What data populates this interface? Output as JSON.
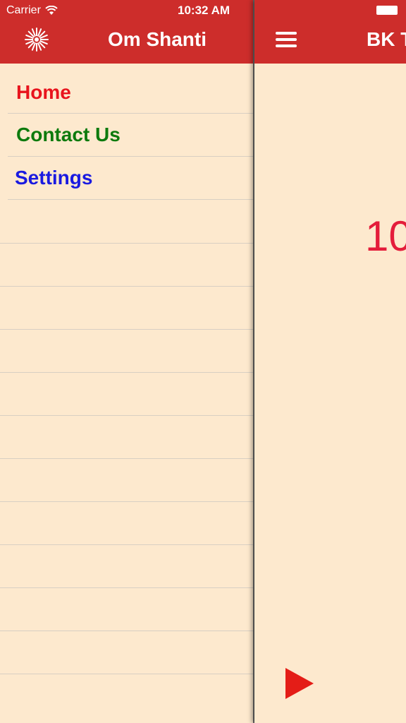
{
  "status_bar": {
    "carrier": "Carrier",
    "time": "10:32 AM"
  },
  "drawer": {
    "title": "Om Shanti",
    "items": [
      {
        "label": "Home",
        "color": "#e8141d"
      },
      {
        "label": "Contact Us",
        "color": "#0d7a0d"
      },
      {
        "label": "Settings",
        "color": "#1a1ae0"
      }
    ]
  },
  "main": {
    "title": "BK T",
    "number": "10"
  },
  "colors": {
    "header": "#cd2d2b",
    "background": "#fde9ce",
    "number": "#e41d3b",
    "play": "#e41d17"
  }
}
